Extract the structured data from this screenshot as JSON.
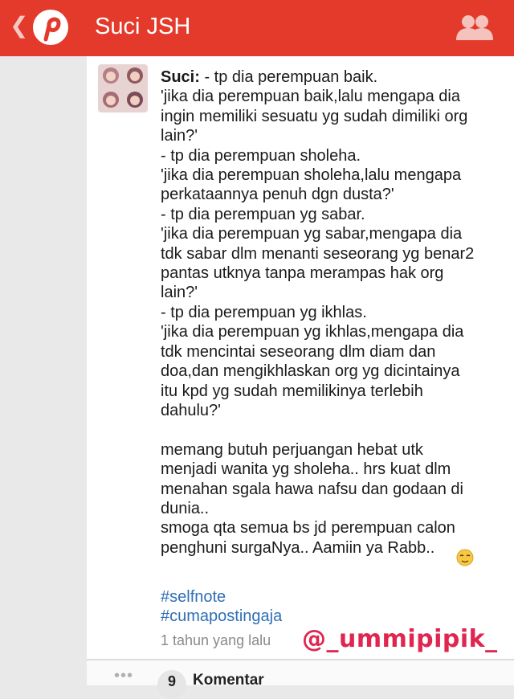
{
  "header": {
    "back_glyph": "❮",
    "title": "Suci JSH",
    "color": "#e33a2c",
    "logo_icon": "pinterest-logo-icon",
    "friends_icon": "people-icon"
  },
  "post": {
    "username": "Suci:",
    "caption": " - tp dia perempuan baik.\n'jika dia perempuan baik,lalu mengapa dia\ningin memiliki sesuatu yg sudah dimiliki org\nlain?'\n- tp dia perempuan sholeha.\n'jika dia perempuan sholeha,lalu mengapa\nperkataannya penuh dgn dusta?'\n- tp dia perempuan yg sabar.\n'jika dia perempuan yg sabar,mengapa dia\ntdk sabar dlm menanti seseorang yg benar2\npantas utknya tanpa merampas hak org\nlain?'\n- tp dia perempuan yg ikhlas.\n'jika dia perempuan yg ikhlas,mengapa dia\ntdk mencintai seseorang dlm diam dan\ndoa,dan mengikhlaskan org yg dicintainya\nitu kpd yg sudah memilikinya terlebih\ndahulu?'\n\nmemang butuh perjuangan hebat utk\nmenjadi wanita yg sholeha.. hrs kuat dlm\nmenahan sgala hawa nafsu dan godaan di\ndunia..\nsmoga qta semua bs jd perempuan calon\npenghuni surgaNya.. Aamiin ya Rabb..",
    "emoji_icon": "relieved-face-emoji-icon",
    "hashtags": [
      "#selfnote",
      "#cumapostingaja"
    ],
    "time": "1 tahun yang lalu",
    "watermark": "@_ummipipik_"
  },
  "footer": {
    "dots": "•••",
    "comment_count": "9",
    "comment_label": "Komentar"
  }
}
